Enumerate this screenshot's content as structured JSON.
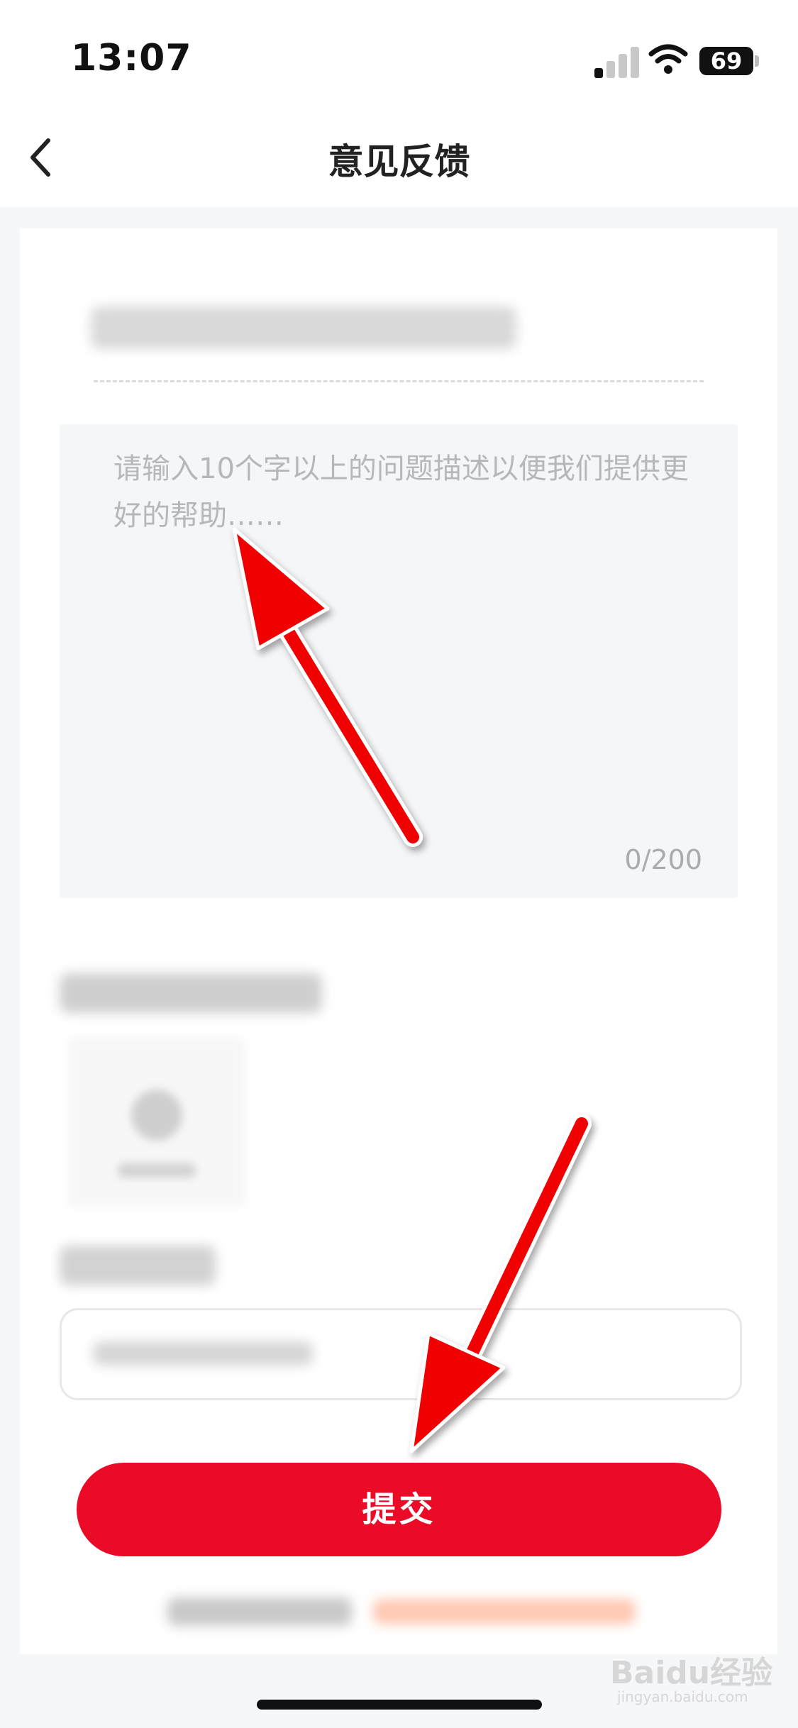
{
  "status_bar": {
    "time": "13:07",
    "battery": "69"
  },
  "nav": {
    "title": "意见反馈"
  },
  "feedback": {
    "placeholder": "请输入10个字以上的问题描述以便我们提供更好的帮助……",
    "counter": "0/200"
  },
  "actions": {
    "submit_label": "提交"
  },
  "watermark": {
    "brand": "Baidu经验",
    "url": "jingyan.baidu.com"
  },
  "colors": {
    "accent": "#ec0b27",
    "annotation_arrow": "#f00000"
  }
}
